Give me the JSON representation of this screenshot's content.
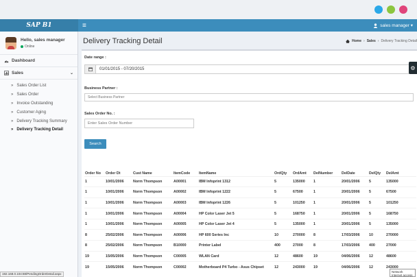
{
  "window": {
    "dots": [
      {
        "name": "blue-dot",
        "color": "#2aa8e8"
      },
      {
        "name": "green-dot",
        "color": "#8cc63f"
      },
      {
        "name": "pink-dot",
        "color": "#e0457b"
      }
    ]
  },
  "header": {
    "logo": "SAP B1",
    "menu_icon": "≡",
    "user_icon": "user-icon",
    "user_label": "sales manager ▾"
  },
  "sidebar": {
    "user_greeting": "Hello, sales manager",
    "user_status": "Online",
    "dashboard": "Dashboard",
    "sales": "Sales",
    "items": [
      {
        "label": "Sales Order List",
        "active": false
      },
      {
        "label": "Sales Order",
        "active": false
      },
      {
        "label": "Invoice Outstanding",
        "active": false
      },
      {
        "label": "Customer Aging",
        "active": false
      },
      {
        "label": "Delivery Tracking Summary",
        "active": false
      },
      {
        "label": "Delivery Tracking Detail",
        "active": true
      }
    ]
  },
  "status_url": "192.168.0.104:88/PendingOrderDetail.aspx",
  "page": {
    "title": "Delivery Tracking Detail",
    "breadcrumb": {
      "home": "Home",
      "sales": "Sales",
      "current": "Delivery Tracking Detail",
      "sep": "›"
    }
  },
  "filters": {
    "date_label": "Date range :",
    "date_value": "01/01/2015 - 07/20/2015",
    "bp_label": "Business Partner :",
    "bp_placeholder": "Select Business Partner",
    "so_label": "Sales Order No. :",
    "so_placeholder": "Enter Sales Order Number",
    "search_button": "Search"
  },
  "table": {
    "headers": [
      "Order No",
      "Order Dt",
      "Cust Name",
      "ItemCode",
      "ItemName",
      "OrdQty",
      "OrdAmt",
      "DelNumber",
      "DelDate",
      "DelQty",
      "DelAmt"
    ],
    "rows": [
      [
        "1",
        "10/01/2006",
        "Norm Thompson",
        "A00001",
        "IBM Infoprint 1312",
        "5",
        "135000",
        "1",
        "20/01/2006",
        "5",
        "135000"
      ],
      [
        "1",
        "10/01/2006",
        "Norm Thompson",
        "A00002",
        "IBM Infoprint 1222",
        "5",
        "67500",
        "1",
        "20/01/2006",
        "5",
        "67500"
      ],
      [
        "1",
        "10/01/2006",
        "Norm Thompson",
        "A00003",
        "IBM Infoprint 1226",
        "5",
        "101250",
        "1",
        "20/01/2006",
        "5",
        "101250"
      ],
      [
        "1",
        "10/01/2006",
        "Norm Thompson",
        "A00004",
        "HP Color Laser Jet 5",
        "5",
        "168750",
        "1",
        "20/01/2006",
        "5",
        "168750"
      ],
      [
        "1",
        "10/01/2006",
        "Norm Thompson",
        "A00005",
        "HP Color Laser Jet 4",
        "5",
        "135000",
        "1",
        "20/01/2006",
        "5",
        "135000"
      ],
      [
        "8",
        "25/02/2006",
        "Norm Thompson",
        "A00006",
        "HP 600 Series Inc",
        "10",
        "270000",
        "8",
        "17/03/2006",
        "10",
        "270000"
      ],
      [
        "8",
        "25/02/2006",
        "Norm Thompson",
        "B10000",
        "Printer Label",
        "400",
        "27000",
        "8",
        "17/03/2006",
        "400",
        "27000"
      ],
      [
        "19",
        "15/05/2006",
        "Norm Thompson",
        "C00005",
        "WLAN Card",
        "12",
        "48600",
        "19",
        "04/06/2006",
        "12",
        "48600"
      ],
      [
        "19",
        "15/05/2006",
        "Norm Thompson",
        "C00002",
        "Motherboard P4 Turbo - Asus Chipset",
        "12",
        "243000",
        "19",
        "04/06/2006",
        "12",
        "243000"
      ]
    ]
  },
  "network_popup": {
    "line1": "Network",
    "line2": "Internet access"
  }
}
